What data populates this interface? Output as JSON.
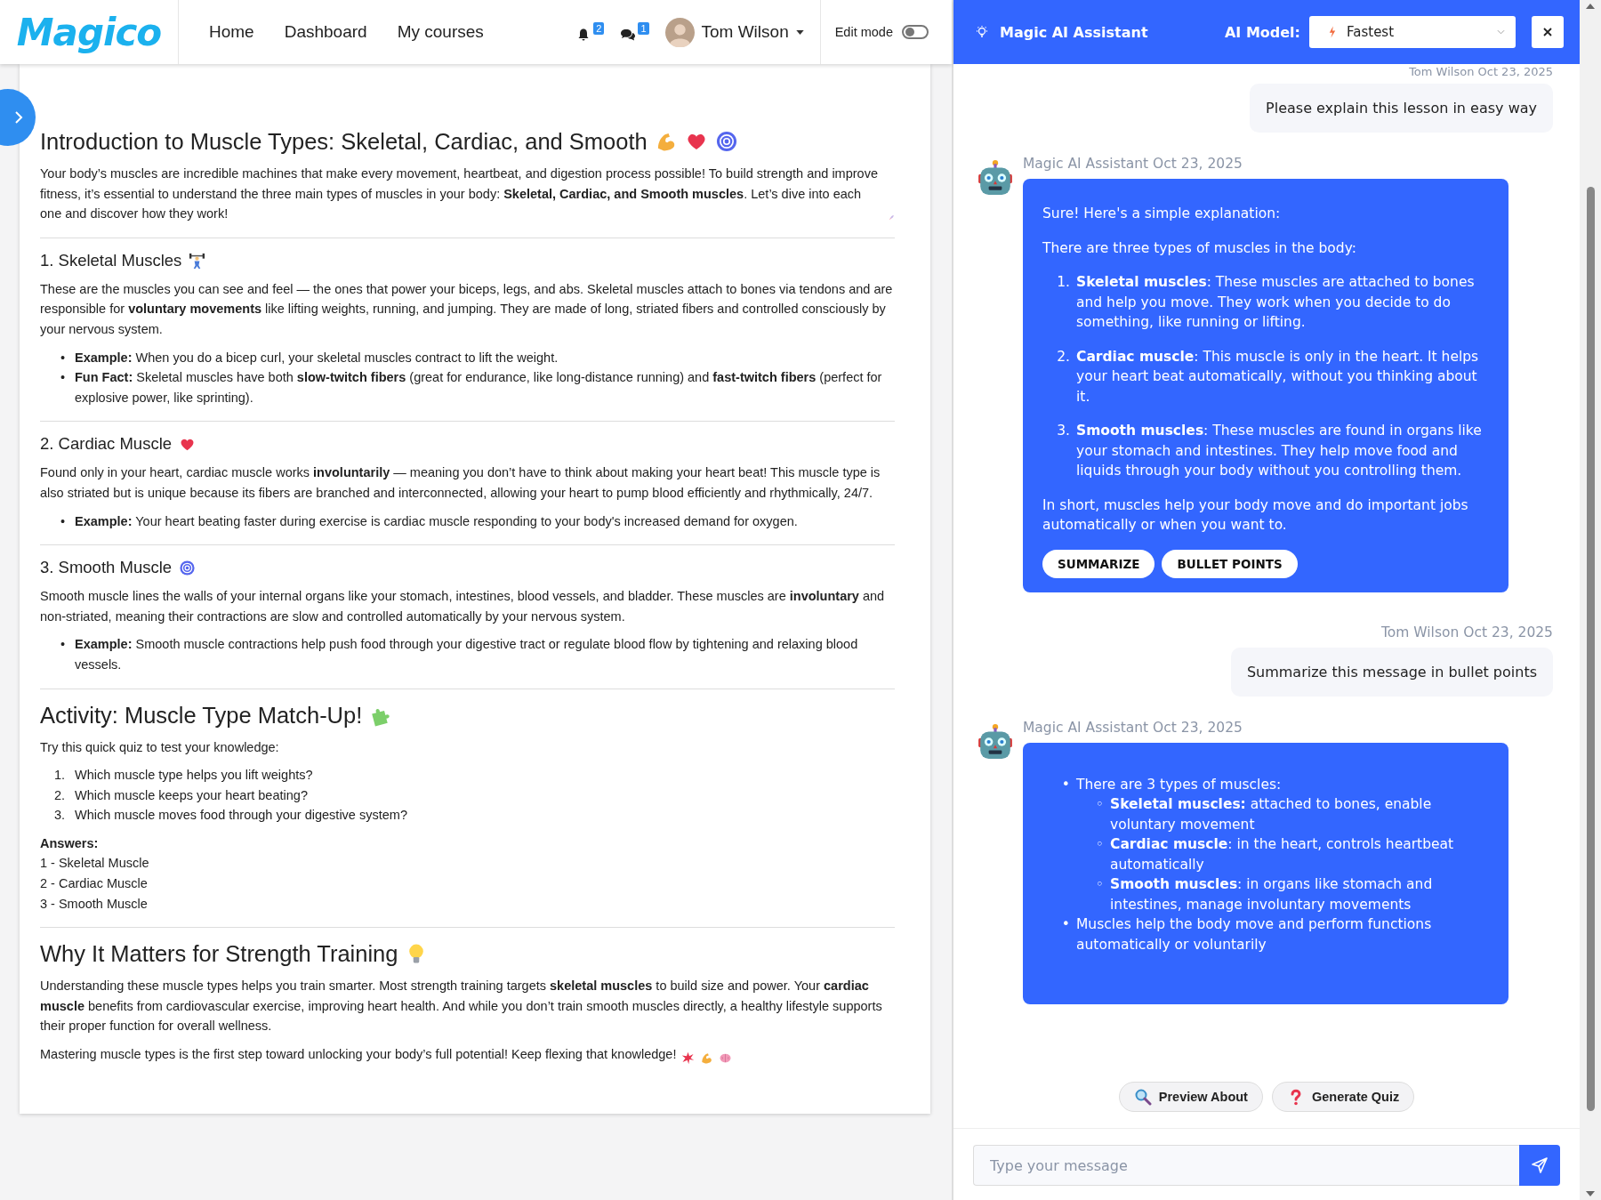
{
  "header": {
    "logo": "Magico",
    "nav": [
      {
        "label": "Home"
      },
      {
        "label": "Dashboard"
      },
      {
        "label": "My courses"
      }
    ],
    "notifications_badge": "2",
    "messages_badge": "1",
    "user": "Tom Wilson",
    "edit_mode": {
      "label": "Edit mode",
      "on": false
    }
  },
  "lesson": {
    "blocks": [
      {
        "kind": "h1",
        "text": "Introduction to Muscle Types: Skeletal, Cardiac, and Smooth"
      },
      {
        "kind": "p",
        "text": "Your body’s muscles are incredible machines that make every movement, heartbeat, and digestion process possible! To build strength and improve fitness, it’s essential to understand the three main types of muscles in your body: **Skeletal, Cardiac, and Smooth muscles**. Let’s dive into each one and discover how they work!"
      },
      {
        "kind": "divider"
      },
      {
        "kind": "h2",
        "text": "1. Skeletal Muscles"
      },
      {
        "kind": "p",
        "text": "These are the muscles you can see and feel — the ones that power your biceps, legs, and abs. Skeletal muscles attach to bones via tendons and are responsible for **voluntary movements** like lifting weights, running, and jumping. They are made of long, striated fibers and controlled consciously by your nervous system."
      },
      {
        "kind": "list",
        "items": [
          {
            "marker": "•",
            "text": "**Example:** When you do a bicep curl, your skeletal muscles contract to lift the weight."
          },
          {
            "marker": "•",
            "text": "**Fun Fact:** Skeletal muscles have both **slow-twitch fibers** (great for endurance, like long-distance running) and **fast-twitch fibers** (perfect for explosive power, like sprinting)."
          }
        ]
      },
      {
        "kind": "divider"
      },
      {
        "kind": "h2",
        "text": "2. Cardiac Muscle"
      },
      {
        "kind": "p",
        "text": "Found only in your heart, cardiac muscle works **involuntarily** — meaning you don’t have to think about making your heart beat! This muscle type is also striated but is unique because its fibers are branched and interconnected, allowing your heart to pump blood efficiently and rhythmically, 24/7."
      },
      {
        "kind": "list",
        "items": [
          {
            "marker": "•",
            "text": "**Example:** Your heart beating faster during exercise is cardiac muscle responding to your body's increased demand for oxygen."
          }
        ]
      },
      {
        "kind": "divider"
      },
      {
        "kind": "h2",
        "text": "3. Smooth Muscle"
      },
      {
        "kind": "p",
        "text": "Smooth muscle lines the walls of your internal organs like your stomach, intestines, blood vessels, and bladder. These muscles are **involuntary** and non-striated, meaning their contractions are slow and controlled automatically by your nervous system."
      },
      {
        "kind": "list",
        "items": [
          {
            "marker": "•",
            "text": "**Example:** Smooth muscle contractions help push food through your digestive tract or regulate blood flow by tightening and relaxing blood vessels."
          }
        ]
      },
      {
        "kind": "divider"
      },
      {
        "kind": "h1",
        "text": "Activity: Muscle Type Match-Up!"
      },
      {
        "kind": "p",
        "text": "Try this quick quiz to test your knowledge:"
      },
      {
        "kind": "list",
        "items": [
          {
            "marker": "1.",
            "text": "Which muscle type helps you lift weights?"
          },
          {
            "marker": "2.",
            "text": "Which muscle keeps your heart beating?"
          },
          {
            "marker": "3.",
            "text": "Which muscle moves food through your digestive system?"
          }
        ]
      },
      {
        "kind": "label",
        "text": "Answers:"
      },
      {
        "kind": "lines",
        "items": [
          "1 - Skeletal Muscle",
          "2 - Cardiac Muscle",
          "3 - Smooth Muscle"
        ]
      },
      {
        "kind": "divider"
      },
      {
        "kind": "h1",
        "text": "Why It Matters for Strength Training"
      },
      {
        "kind": "p",
        "text": "Understanding these muscle types helps you train smarter. Most strength training targets **skeletal muscles** to build size and power. Your **cardiac muscle** benefits from cardiovascular exercise, improving heart health. And while you don’t train smooth muscles directly, a healthy lifestyle supports their proper function for overall wellness."
      },
      {
        "kind": "p",
        "text": "Mastering muscle types is the first step toward unlocking your body’s full potential! Keep flexing that knowledge!"
      }
    ]
  },
  "assistant": {
    "title": "Magic AI Assistant",
    "model_label": "AI Model:",
    "model": "Fastest",
    "messages": [
      {
        "kind": "user",
        "meta": "Tom Wilson Oct 23, 2025",
        "text": "Please explain this lesson in easy way"
      },
      {
        "kind": "assistant",
        "meta": "Magic AI Assistant Oct 23, 2025",
        "blocks": [
          {
            "kind": "p",
            "text": "Sure! Here's a simple explanation:"
          },
          {
            "kind": "p",
            "text": "There are three types of muscles in the body:"
          },
          {
            "kind": "ol",
            "items": [
              {
                "marker": "1.",
                "text": "**Skeletal muscles**: These muscles are attached to bones and help you move. They work when you decide to do something, like running or lifting."
              },
              {
                "marker": "2.",
                "text": "**Cardiac muscle**: This muscle is only in the heart. It helps your heart beat automatically, without you thinking about it."
              },
              {
                "marker": "3.",
                "text": "**Smooth muscles**: These muscles are found in organs like your stomach and intestines. They help move food and liquids through your body without you controlling them."
              }
            ]
          },
          {
            "kind": "p",
            "text": "In short, muscles help your body move and do important jobs automatically or when you want to."
          }
        ],
        "actions": [
          "SUMMARIZE",
          "BULLET POINTS"
        ]
      },
      {
        "kind": "user",
        "meta": "Tom Wilson Oct 23, 2025",
        "text": "Summarize this message in bullet points"
      },
      {
        "kind": "assistant",
        "meta": "Magic AI Assistant Oct 23, 2025",
        "blocks": [
          {
            "kind": "ul",
            "items": [
              {
                "marker": "•",
                "text": "There are 3 types of muscles:",
                "children": [
                  {
                    "marker": "◦",
                    "text": "**Skeletal muscles:** attached to bones, enable voluntary movement"
                  },
                  {
                    "marker": "◦",
                    "text": "**Cardiac muscle**: in the heart, controls heartbeat automatically"
                  },
                  {
                    "marker": "◦",
                    "text": "**Smooth muscles**: in organs like stomach and intestines, manage involuntary movements"
                  }
                ]
              },
              {
                "marker": "•",
                "text": "Muscles help the body move and perform functions automatically or voluntarily"
              }
            ]
          }
        ]
      }
    ],
    "quick_actions": [
      {
        "label": "Preview About"
      },
      {
        "label": "Generate Quiz"
      }
    ],
    "input": {
      "placeholder": "Type your message"
    }
  }
}
